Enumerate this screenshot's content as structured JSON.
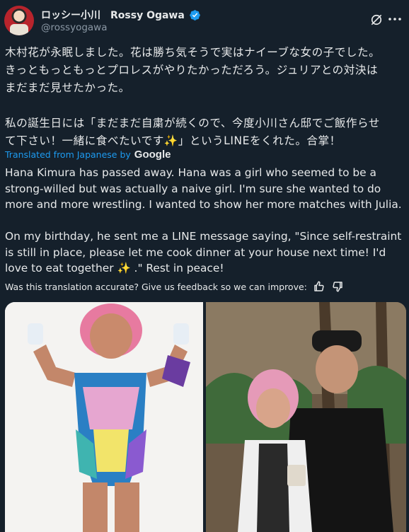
{
  "author": {
    "display_name": "ロッシー小川　Rossy Ogawa",
    "handle": "@rossyogawa"
  },
  "tweet": {
    "japanese_text": "木村花が永眠しました。花は勝ち気そうで実はナイーブな女の子でした。\nきっともっともっとプロレスがやりたかっただろう。ジュリアとの対決は\nまだまだ見せたかった。\n\n私の誕生日には「まだまだ自粛が続くので、今度小川さん邸でご飯作らせ\nて下さい！一緒に食べたいです✨」というLINEをくれた。合掌！",
    "translated_label": "Translated from Japanese by",
    "translator": "Google",
    "english_text": "Hana Kimura has passed away. Hana was a girl who seemed to be a\nstrong-willed but was actually a naive girl. I'm sure she wanted to do\nmore and more wrestling. I wanted to show her more matches with Julia.\n\nOn my birthday, he sent me a LINE message saying, \"Since self-restraint\nis still in place, please let me cook dinner at your house next time! I'd\nlove to eat together ✨ .\" Rest in peace!",
    "feedback_prompt": "Was this translation accurate? Give us feedback so we can improve:"
  },
  "icons": {
    "verified": "verified-badge-icon",
    "grok": "grok-icon",
    "more": "more-options-icon",
    "thumbs_up": "thumbs-up-icon",
    "thumbs_down": "thumbs-down-icon"
  },
  "colors": {
    "background": "#15202b",
    "text": "#e7e9ea",
    "secondary_text": "#8b98a5",
    "link": "#1d9bf0"
  }
}
